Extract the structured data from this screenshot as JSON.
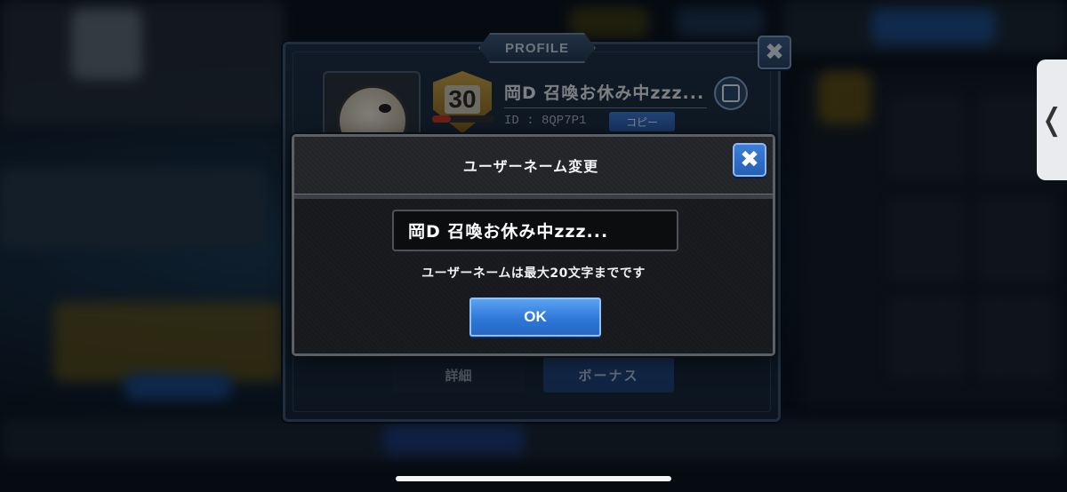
{
  "profile": {
    "tab_label": "PROFILE",
    "close_glyph": "✖",
    "rank": "30",
    "rank_progress": 0.3,
    "name": "岡D 召喚お休み中zzz...",
    "id_text": "ID : 8QP7P1",
    "copy_label": "コピー",
    "detail_label": "詳細",
    "bonus_label": "ボーナス"
  },
  "modal": {
    "title": "ユーザーネーム変更",
    "close_glyph": "✖",
    "input_value": "岡D 召喚お休み中zzz...",
    "hint": "ユーザーネームは最大20文字までです",
    "ok_label": "OK"
  },
  "side_handle": {
    "glyph": "❬"
  },
  "icons": {
    "profile_close": "close-icon",
    "modal_close": "close-icon",
    "edit": "pencil-icon",
    "side_handle": "chevron-left-icon"
  },
  "colors": {
    "accent_blue": "#2e78d8",
    "modal_bg": "#1e1f22",
    "panel_bg": "#1d3045"
  }
}
